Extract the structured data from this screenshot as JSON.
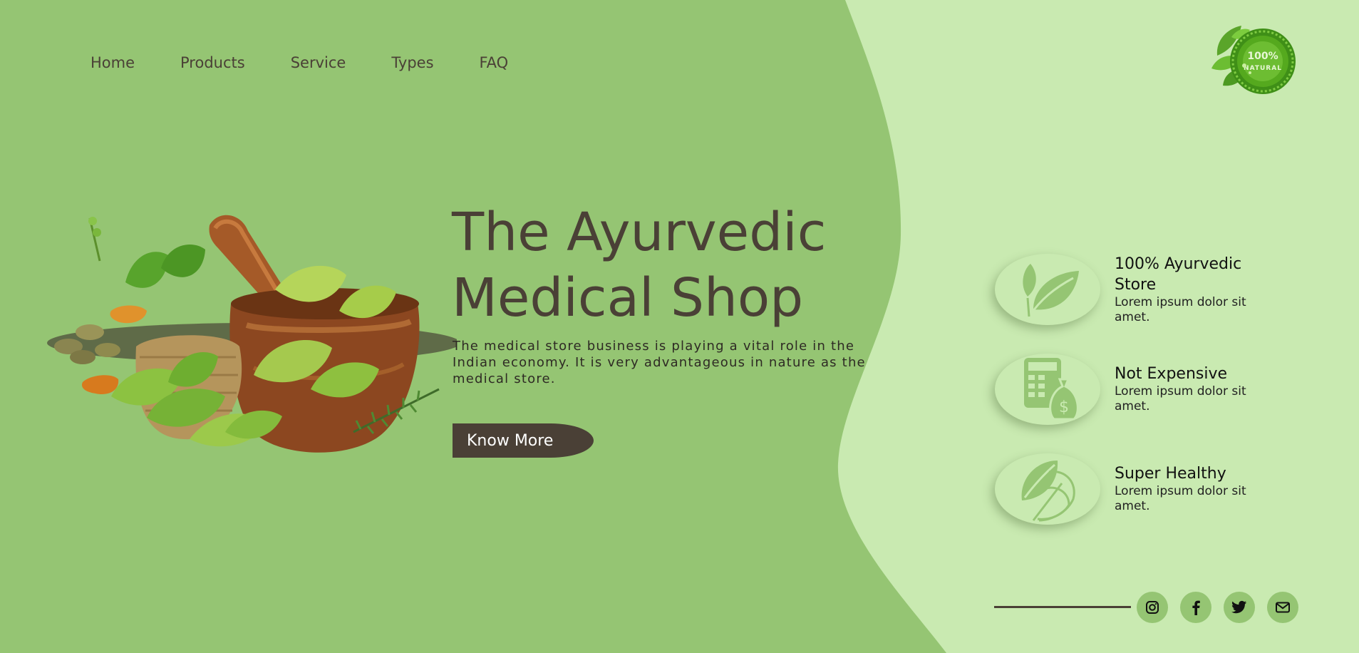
{
  "nav": {
    "items": [
      "Home",
      "Products",
      "Service",
      "Types",
      "FAQ"
    ]
  },
  "logo": {
    "top_text": "100%",
    "bottom_text": "NATURAL"
  },
  "hero": {
    "title_line1": "The Ayurvedic",
    "title_line2": "Medical Shop",
    "description": "The medical store business is playing a vital role in the Indian economy. It is very advantageous in nature as the medical store.",
    "cta_label": "Know More"
  },
  "features": [
    {
      "title": "100% Ayurvedic Store",
      "text": "Lorem ipsum dolor sit amet.",
      "icon": "leaf-icon"
    },
    {
      "title": "Not Expensive",
      "text": "Lorem ipsum dolor sit amet.",
      "icon": "calculator-money-icon"
    },
    {
      "title": "Super Healthy",
      "text": "Lorem ipsum dolor sit amet.",
      "icon": "herbs-icon"
    }
  ],
  "social": [
    "instagram-icon",
    "facebook-icon",
    "twitter-icon",
    "mail-icon"
  ],
  "colors": {
    "primary_green": "#95c573",
    "light_green": "#c9eab1",
    "dark_brown": "#4a4036"
  }
}
